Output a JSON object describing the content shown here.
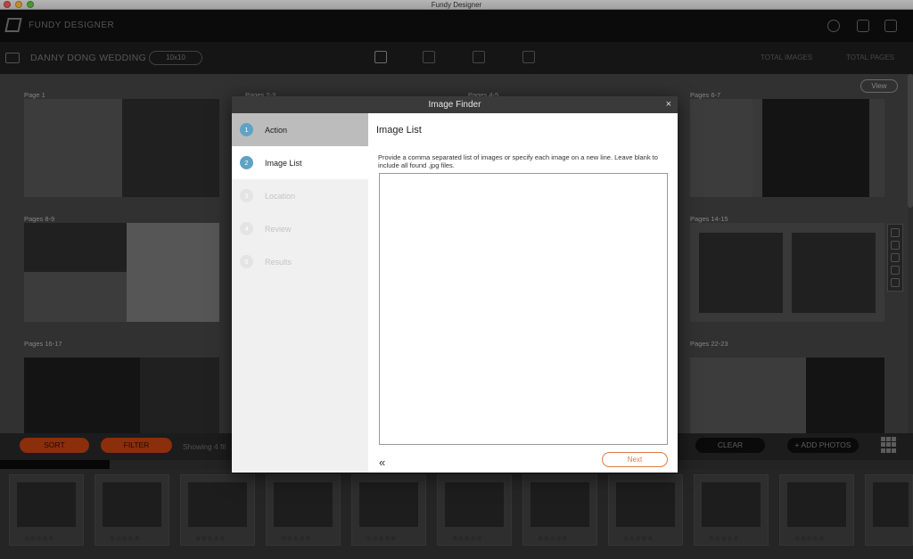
{
  "window": {
    "title": "Fundy Designer"
  },
  "app": {
    "brand": "FUNDY DESIGNER"
  },
  "project": {
    "name": "DANNY DONG WEDDING",
    "size": "10x10",
    "stat_total_images": "TOTAL IMAGES",
    "stat_total_pages": "TOTAL PAGES"
  },
  "workspace": {
    "view_label": "View",
    "spreads": [
      "Page 1",
      "Pages 2-3",
      "Pages 4-5",
      "Pages 6-7",
      "Pages 8-9",
      "Pages 14-15",
      "Pages 16-17",
      "Pages 22-23"
    ]
  },
  "bottombar": {
    "sort_label": "SORT",
    "filter_label": "FILTER",
    "showing_text": "Showing 4 fil",
    "clear_label": "CLEAR",
    "add_photos_label": "+ ADD PHOTOS",
    "progress": 0.12
  },
  "filmstrip": {
    "rating_stars": "☆☆☆☆☆"
  },
  "modal": {
    "title": "Image Finder",
    "close_glyph": "×",
    "steps": [
      {
        "num": "1",
        "label": "Action"
      },
      {
        "num": "2",
        "label": "Image List"
      },
      {
        "num": "3",
        "label": "Location"
      },
      {
        "num": "4",
        "label": "Review"
      },
      {
        "num": "5",
        "label": "Results"
      }
    ],
    "heading": "Image List",
    "description": "Provide a comma separated list of images or specify each image on a new line.  Leave blank to include all found .jpg files.",
    "textarea_value": "",
    "back_glyph": "«",
    "next_label": "Next"
  }
}
